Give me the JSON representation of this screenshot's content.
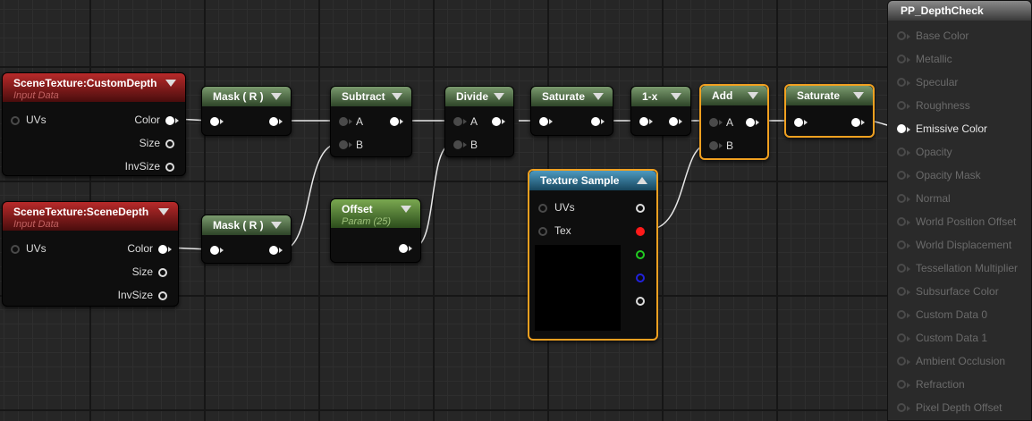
{
  "nodes": {
    "custom_depth": {
      "title": "SceneTexture:CustomDepth",
      "subtitle": "Input Data",
      "inputs": [
        "UVs"
      ],
      "outputs": [
        "Color",
        "Size",
        "InvSize"
      ]
    },
    "scene_depth": {
      "title": "SceneTexture:SceneDepth",
      "subtitle": "Input Data",
      "inputs": [
        "UVs"
      ],
      "outputs": [
        "Color",
        "Size",
        "InvSize"
      ]
    },
    "mask_top": {
      "title": "Mask ( R )"
    },
    "mask_bottom": {
      "title": "Mask ( R )"
    },
    "subtract": {
      "title": "Subtract",
      "inputs": [
        "A",
        "B"
      ]
    },
    "offset": {
      "title": "Offset",
      "subtitle": "Param (25)"
    },
    "divide": {
      "title": "Divide",
      "inputs": [
        "A",
        "B"
      ]
    },
    "saturate1": {
      "title": "Saturate"
    },
    "one_minus": {
      "title": "1-x"
    },
    "texture_sample": {
      "title": "Texture Sample",
      "inputs": [
        "UVs",
        "Tex"
      ]
    },
    "add": {
      "title": "Add",
      "inputs": [
        "A",
        "B"
      ]
    },
    "saturate2": {
      "title": "Saturate"
    }
  },
  "output_node": {
    "title": "PP_DepthCheck",
    "pins": [
      "Base Color",
      "Metallic",
      "Specular",
      "Roughness",
      "Emissive Color",
      "Opacity",
      "Opacity Mask",
      "Normal",
      "World Position Offset",
      "World Displacement",
      "Tessellation Multiplier",
      "Subsurface Color",
      "Custom Data 0",
      "Custom Data 1",
      "Ambient Occlusion",
      "Refraction",
      "Pixel Depth Offset"
    ],
    "active_pin": "Emissive Color"
  },
  "colors": {
    "wire": "#e8e8e8",
    "selection": "#f0a020",
    "red_pin": "#ff1a1a",
    "green_pin": "#22cc22",
    "blue_pin": "#2222dd"
  }
}
